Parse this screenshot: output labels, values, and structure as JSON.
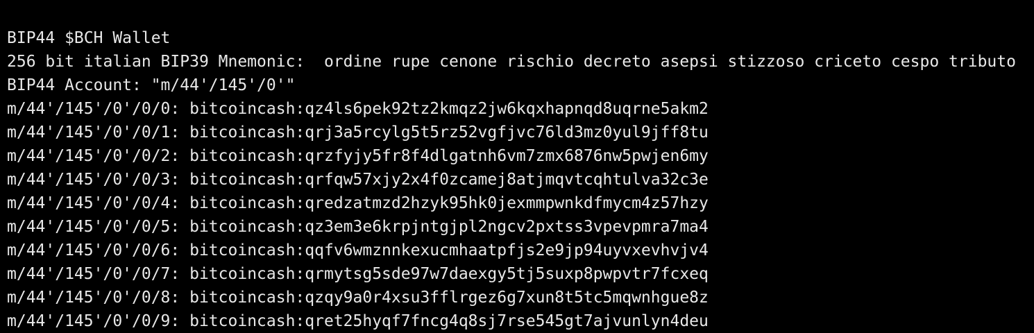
{
  "terminal": {
    "top_partial_line": "",
    "wallet_title": "BIP44 $BCH Wallet",
    "mnemonic_line": "256 bit italian BIP39 Mnemonic:  ordine rupe cenone rischio decreto asepsi stizzoso criceto cespo tributo",
    "account_line": "BIP44 Account: \"m/44'/145'/0'\"",
    "addresses": [
      {
        "path": "m/44'/145'/0'/0/0:",
        "address": "bitcoincash:qz4ls6pek92tz2kmqz2jw6kqxhapnqd8uqrne5akm2"
      },
      {
        "path": "m/44'/145'/0'/0/1:",
        "address": "bitcoincash:qrj3a5rcylg5t5rz52vgfjvc76ld3mz0yul9jff8tu"
      },
      {
        "path": "m/44'/145'/0'/0/2:",
        "address": "bitcoincash:qrzfyjy5fr8f4dlgatnh6vm7zmx6876nw5pwjen6my"
      },
      {
        "path": "m/44'/145'/0'/0/3:",
        "address": "bitcoincash:qrfqw57xjy2x4f0zcamej8atjmqvtcqhtulva32c3e"
      },
      {
        "path": "m/44'/145'/0'/0/4:",
        "address": "bitcoincash:qredzatmzd2hzyk95hk0jexmmpwnkdfmycm4z57hzy"
      },
      {
        "path": "m/44'/145'/0'/0/5:",
        "address": "bitcoincash:qz3em3e6krpjntgjpl2ngcv2pxtss3vpevpmra7ma4"
      },
      {
        "path": "m/44'/145'/0'/0/6:",
        "address": "bitcoincash:qqfv6wmznnkexucmhaatpfjs2e9jp94uyvxevhvjv4"
      },
      {
        "path": "m/44'/145'/0'/0/7:",
        "address": "bitcoincash:qrmytsg5sde97w7daexgy5tj5suxp8pwpvtr7fcxeq"
      },
      {
        "path": "m/44'/145'/0'/0/8:",
        "address": "bitcoincash:qzqy9a0r4xsu3fflrgez6g7xun8t5tc5mqwnhgue8z"
      },
      {
        "path": "m/44'/145'/0'/0/9:",
        "address": "bitcoincash:qret25hyqf7fncg4q8sj7rse545gt7ajvunlyn4deu"
      }
    ],
    "colors": {
      "background": "#000000",
      "text": "#e8e8e8"
    }
  }
}
